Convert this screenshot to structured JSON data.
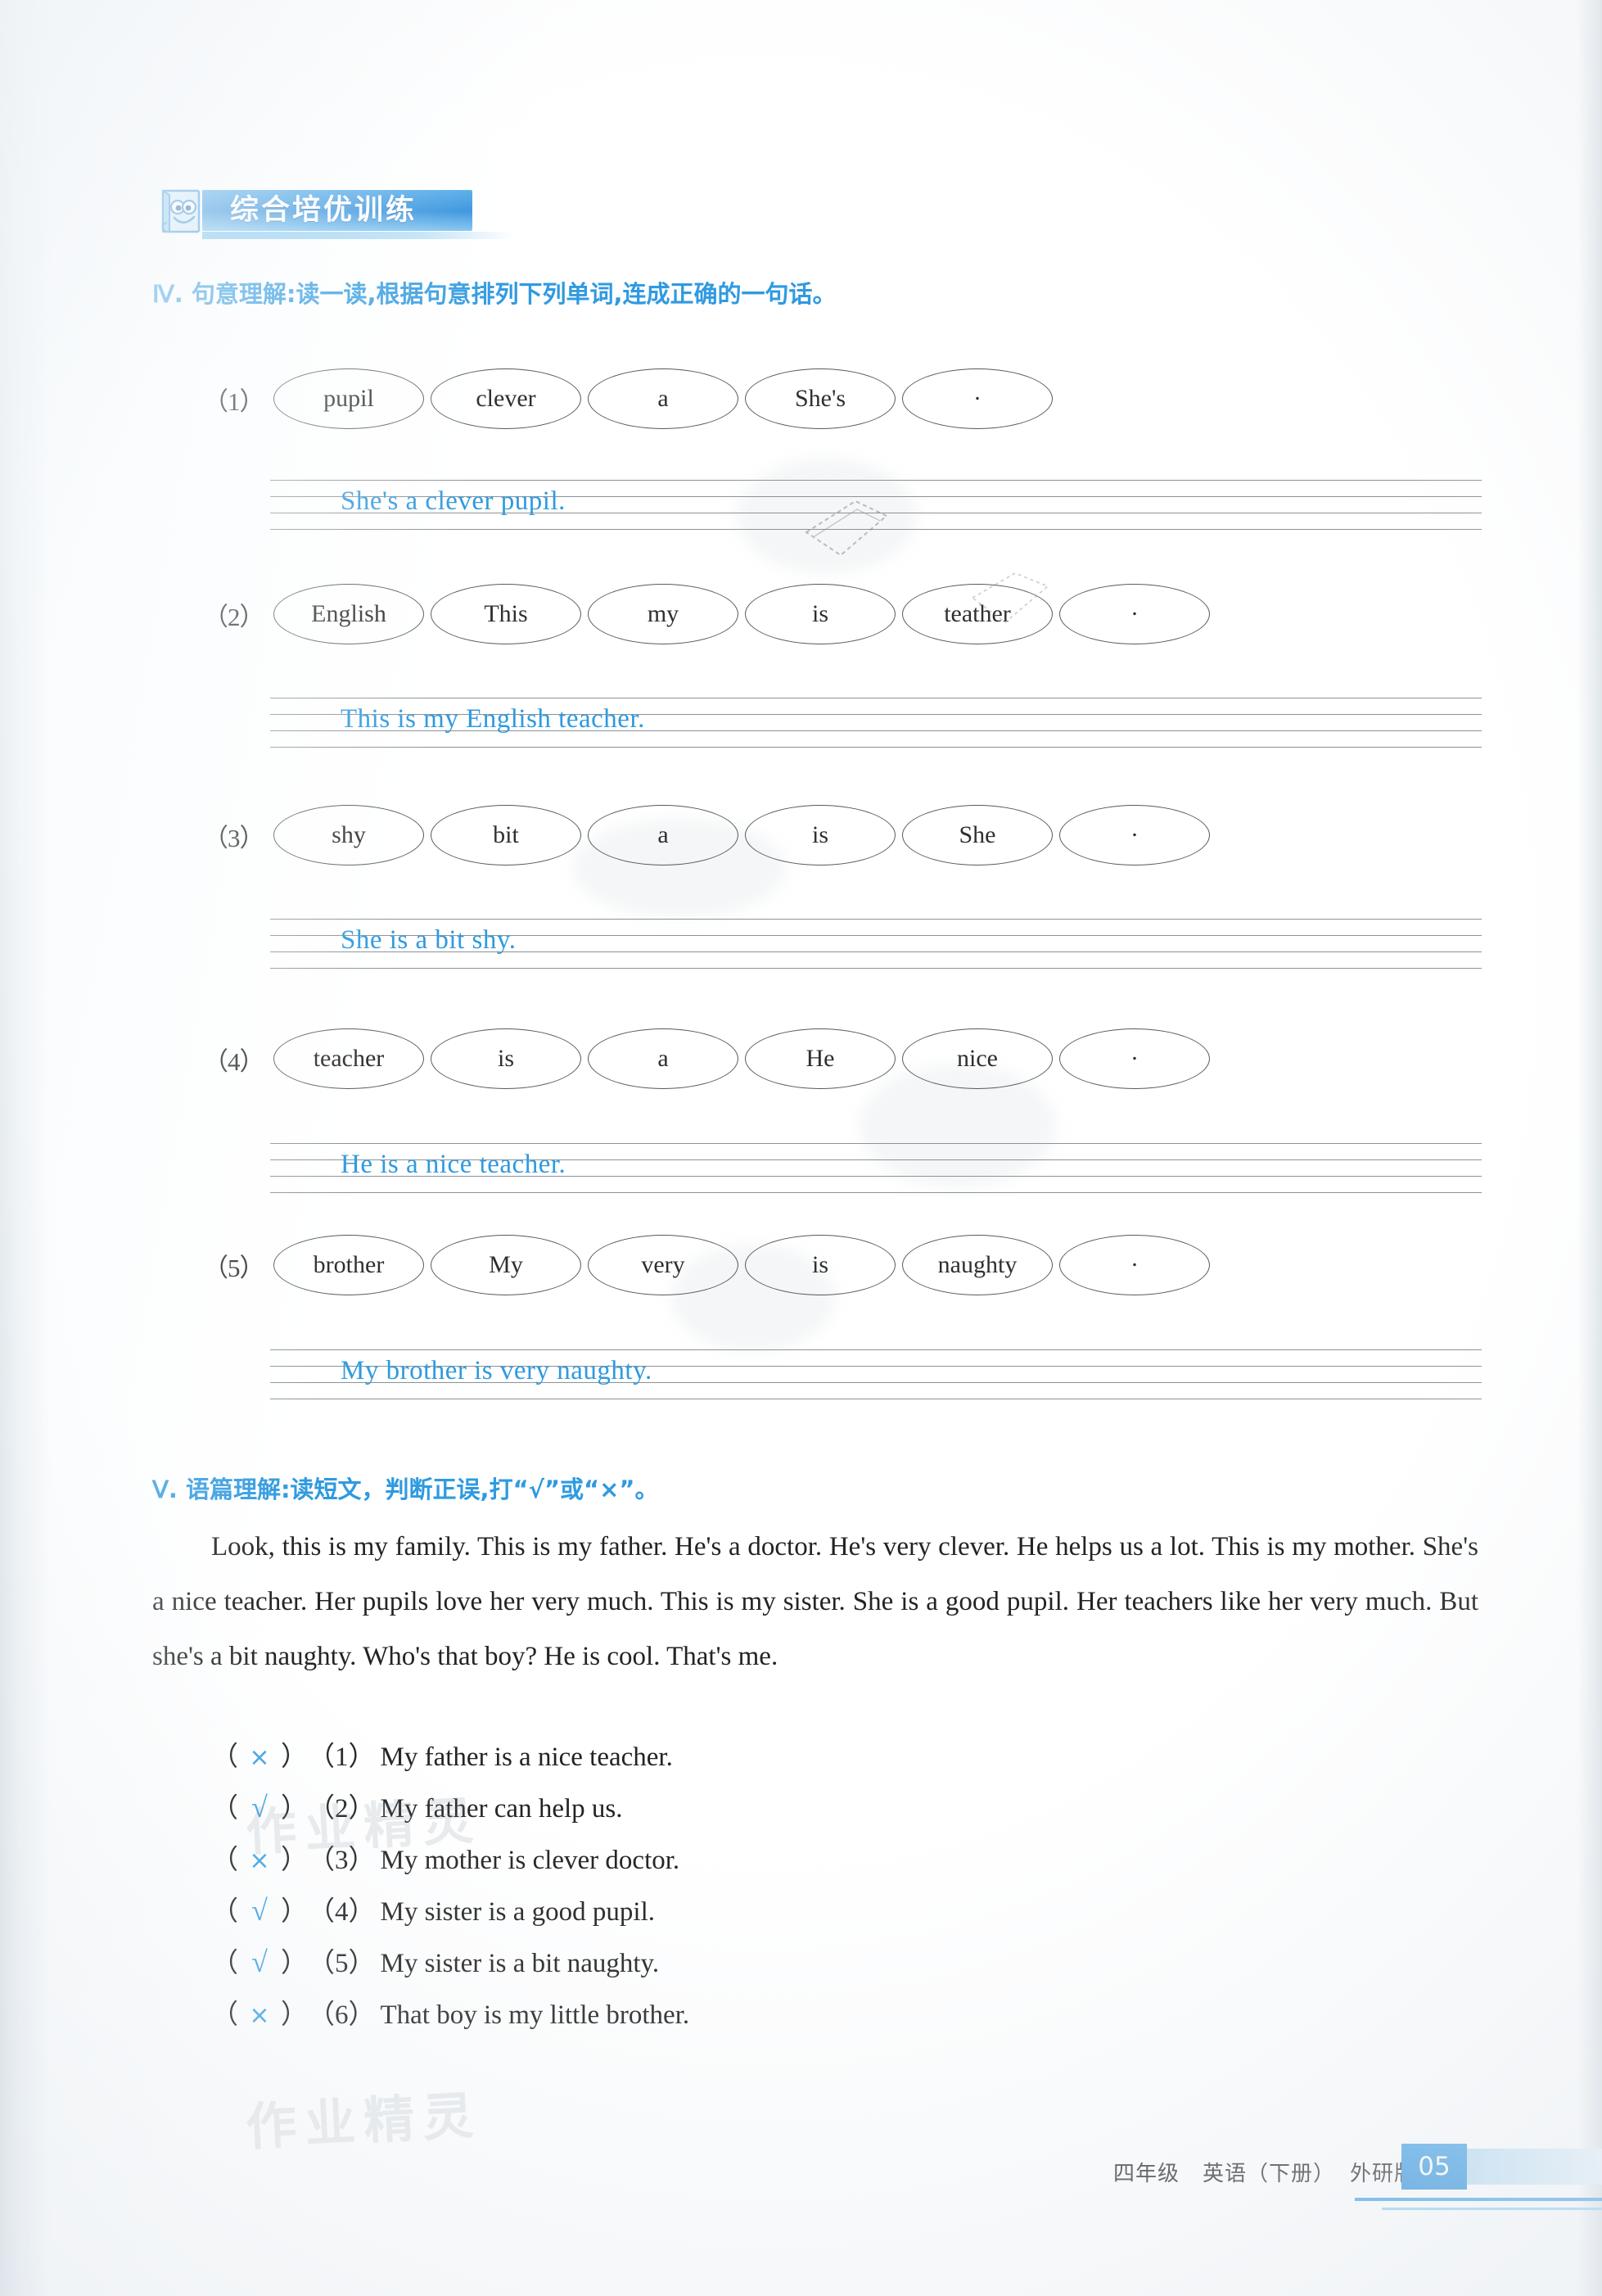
{
  "header": {
    "banner_title": "综合培优训练",
    "mascot": "book-mascot"
  },
  "section4": {
    "roman": "Ⅳ",
    "heading": ". 句意理解:读一读,根据句意排列下列单词,连成正确的一句话。",
    "questions": [
      {
        "number": "（1）",
        "words": [
          "pupil",
          "clever",
          "a",
          "She's",
          "."
        ],
        "answer": "She's a clever pupil."
      },
      {
        "number": "（2）",
        "words": [
          "English",
          "This",
          "my",
          "is",
          "teather",
          "."
        ],
        "answer": "This is my English teacher."
      },
      {
        "number": "（3）",
        "words": [
          "shy",
          "bit",
          "a",
          "is",
          "She",
          "."
        ],
        "answer": "She is a bit shy."
      },
      {
        "number": "（4）",
        "words": [
          "teacher",
          "is",
          "a",
          "He",
          "nice",
          "."
        ],
        "answer": "He is a nice teacher."
      },
      {
        "number": "（5）",
        "words": [
          "brother",
          "My",
          "very",
          "is",
          "naughty",
          "."
        ],
        "answer": "My brother is very naughty."
      }
    ]
  },
  "section5": {
    "roman": "Ⅴ",
    "heading": ". 语篇理解:读短文，判断正误,打“√”或“×”。",
    "passage": "Look, this is my family. This is my father. He's a doctor. He's very clever. He helps us a lot. This is my mother. She's a nice teacher. Her pupils love her very much. This is my sister. She is a good pupil. Her teachers like her very much. But she's a bit naughty. Who's that boy? He is cool. That's me.",
    "tf_items": [
      {
        "mark": "×",
        "number": "（1）",
        "text": "My father is a nice teacher."
      },
      {
        "mark": "√",
        "number": "（2）",
        "text": "My father can help us."
      },
      {
        "mark": "×",
        "number": "（3）",
        "text": "My mother is clever doctor."
      },
      {
        "mark": "√",
        "number": "（4）",
        "text": "My sister is a good pupil."
      },
      {
        "mark": "√",
        "number": "（5）",
        "text": "My sister is a bit naughty."
      },
      {
        "mark": "×",
        "number": "（6）",
        "text": "That boy is my little brother."
      }
    ]
  },
  "footer": {
    "grade": "四年级",
    "subject": "英语",
    "volume": "（下册）",
    "edition": "外研版",
    "page_number": "05"
  },
  "watermarks": {
    "text_a": "作业精灵",
    "text_b": "作业精灵",
    "stamp": "作业精灵"
  },
  "colors": {
    "accent_blue": "#2f9ae0",
    "answer_blue": "#2f9ae0",
    "mark_blue": "#3aa3e3",
    "ink": "#232323"
  }
}
